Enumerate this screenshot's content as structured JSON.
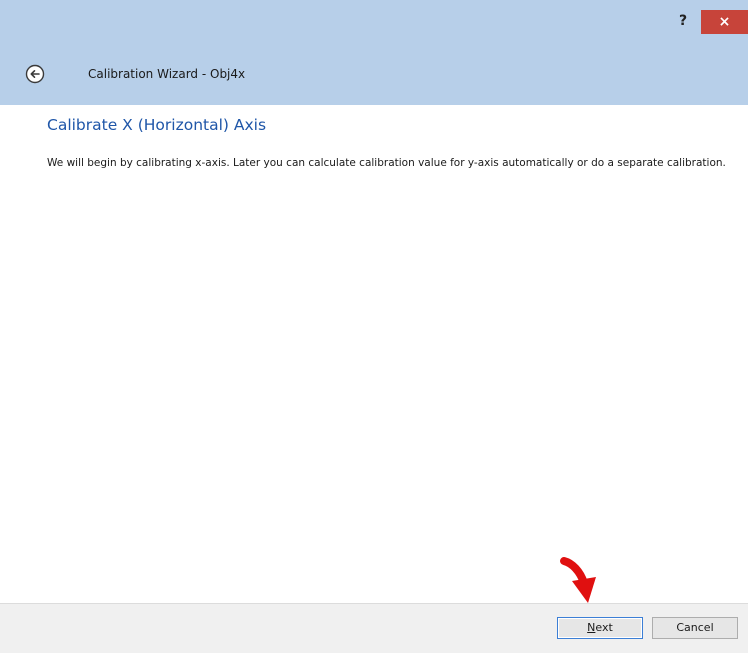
{
  "window": {
    "title": "Calibration Wizard - Obj4x",
    "help_label": "?",
    "close_label": "×"
  },
  "page": {
    "heading": "Calibrate X (Horizontal) Axis",
    "description": "We will begin by calibrating x-axis. Later you can calculate calibration value for y-axis automatically or do a separate calibration."
  },
  "footer": {
    "next_accel": "N",
    "next_rest": "ext",
    "cancel_label": "Cancel"
  },
  "colors": {
    "titlebar": "#b7cfe9",
    "close": "#c7443a",
    "heading": "#1f56a8",
    "annotation_arrow": "#e01010"
  },
  "icons": {
    "back": "back-arrow-circle-icon",
    "annotation": "red-arrow-pointer-icon"
  }
}
